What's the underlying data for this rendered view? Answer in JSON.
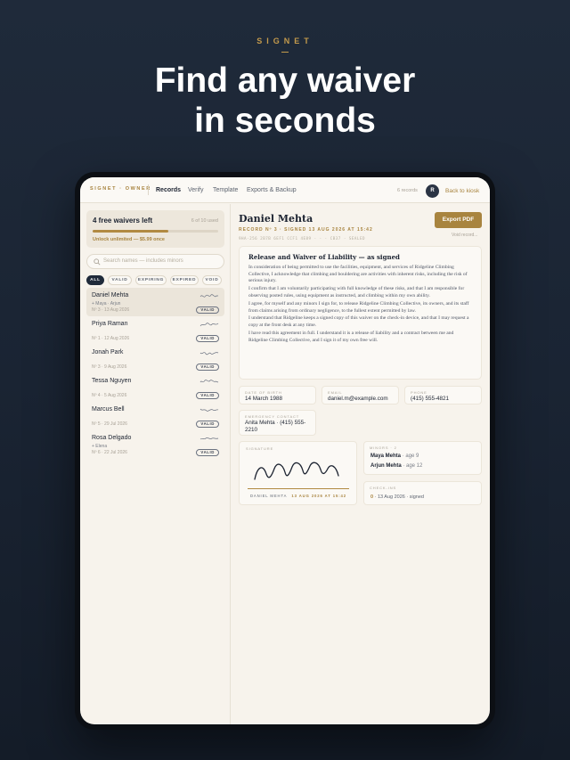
{
  "promo": {
    "brand": "SIGNET",
    "headline_line1": "Find any waiver",
    "headline_line2": "in seconds"
  },
  "nav": {
    "brand": "SIGNET · OWNER",
    "links": [
      "Records",
      "Verify",
      "Template",
      "Exports & Backup"
    ],
    "active": "Records",
    "record_count": "6 records",
    "avatar_initial": "R",
    "kiosk_link": "Back to kiosk"
  },
  "quota": {
    "title": "4 free waivers left",
    "used": "6 of 10 used",
    "progress_fraction": 0.6,
    "upsell": "Unlock unlimited — $5.99 once"
  },
  "search": {
    "placeholder": "Search names — includes minors"
  },
  "filters": [
    "ALL",
    "VALID",
    "EXPIRING",
    "EXPIRED",
    "VOID"
  ],
  "records": [
    {
      "name": "Daniel Mehta",
      "minors": "+ Maya · Arjun",
      "meta": "Nº 3 · 13 Aug 2026",
      "status": "VALID",
      "selected": true
    },
    {
      "name": "Priya Raman",
      "minors": "",
      "meta": "Nº 1 · 12 Aug 2026",
      "status": "VALID"
    },
    {
      "name": "Jonah Park",
      "minors": "",
      "meta": "Nº 3 · 9 Aug 2026",
      "status": "VALID"
    },
    {
      "name": "Tessa Nguyen",
      "minors": "",
      "meta": "Nº 4 · 5 Aug 2026",
      "status": "VALID"
    },
    {
      "name": "Marcus Bell",
      "minors": "",
      "meta": "Nº 5 · 29 Jul 2026",
      "status": "VALID"
    },
    {
      "name": "Rosa Delgado",
      "minors": "+ Elena",
      "meta": "Nº 6 · 22 Jul 2026",
      "status": "VALID"
    }
  ],
  "detail": {
    "name": "Daniel Mehta",
    "meta": "RECORD Nº 3 · SIGNED 13 AUG 2026 AT 15:42",
    "hash": "9HA-256 2B7B 6EF1 CCF1 4E89 · · · CB37 · SEALED",
    "export_button": "Export PDF",
    "void_link": "Void record...",
    "waiver_title": "Release and Waiver of Liability — as signed",
    "waiver_paragraphs": [
      "In consideration of being permitted to use the facilities, equipment, and services of Ridgeline Climbing Collective, I acknowledge that climbing and bouldering are activities with inherent risks, including the risk of serious injury.",
      "I confirm that I am voluntarily participating with full knowledge of these risks, and that I am responsible for observing posted rules, using equipment as instructed, and climbing within my own ability.",
      "I agree, for myself and any minors I sign for, to release Ridgeline Climbing Collective, its owners, and its staff from claims arising from ordinary negligence, to the fullest extent permitted by law.",
      "I understand that Ridgeline keeps a signed copy of this waiver on the check-in device, and that I may request a copy at the front desk at any time.",
      "I have read this agreement in full. I understand it is a release of liability and a contract between me and Ridgeline Climbing Collective, and I sign it of my own free will."
    ],
    "fields": [
      {
        "label": "DATE OF BIRTH",
        "value": "14 March 1988"
      },
      {
        "label": "EMAIL",
        "value": "daniel.m@example.com"
      },
      {
        "label": "PHONE",
        "value": "(415) 555-4821"
      },
      {
        "label": "EMERGENCY CONTACT",
        "value": "Anita Mehta · (415) 555-2210"
      }
    ],
    "signature": {
      "label": "SIGNATURE",
      "name": "DANIEL MEHTA",
      "date": "13 AUG 2026 AT 15:42"
    },
    "minors": {
      "label": "MINORS · 2",
      "items": [
        {
          "name": "Maya Mehta",
          "age": "· age 9"
        },
        {
          "name": "Arjun Mehta",
          "age": "· age 12"
        }
      ]
    },
    "checkins": {
      "label": "CHECK-INS",
      "count": "0",
      "text": "· 13 Aug 2026 · signed"
    }
  },
  "colors": {
    "accent": "#a8843f",
    "navy": "#1f2a3a",
    "paper": "#f7f3ec"
  }
}
